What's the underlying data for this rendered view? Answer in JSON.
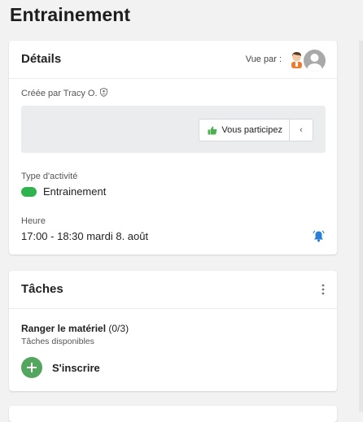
{
  "page": {
    "title": "Entrainement"
  },
  "details": {
    "title": "Détails",
    "seen_by_label": "Vue par :",
    "created_by": "Créée par Tracy O.",
    "participate_label": "Vous participez",
    "chevron": "‹",
    "activity_type_label": "Type d'activité",
    "activity_type_value": "Entrainement",
    "activity_color": "#2fb34f",
    "time_label": "Heure",
    "time_value": "17:00 - 18:30 mardi 8. août"
  },
  "tasks": {
    "title": "Tâches",
    "task_name": "Ranger le matériel",
    "task_count": "(0/3)",
    "task_status": "Tâches disponibles",
    "signup_label": "S'inscrire"
  }
}
